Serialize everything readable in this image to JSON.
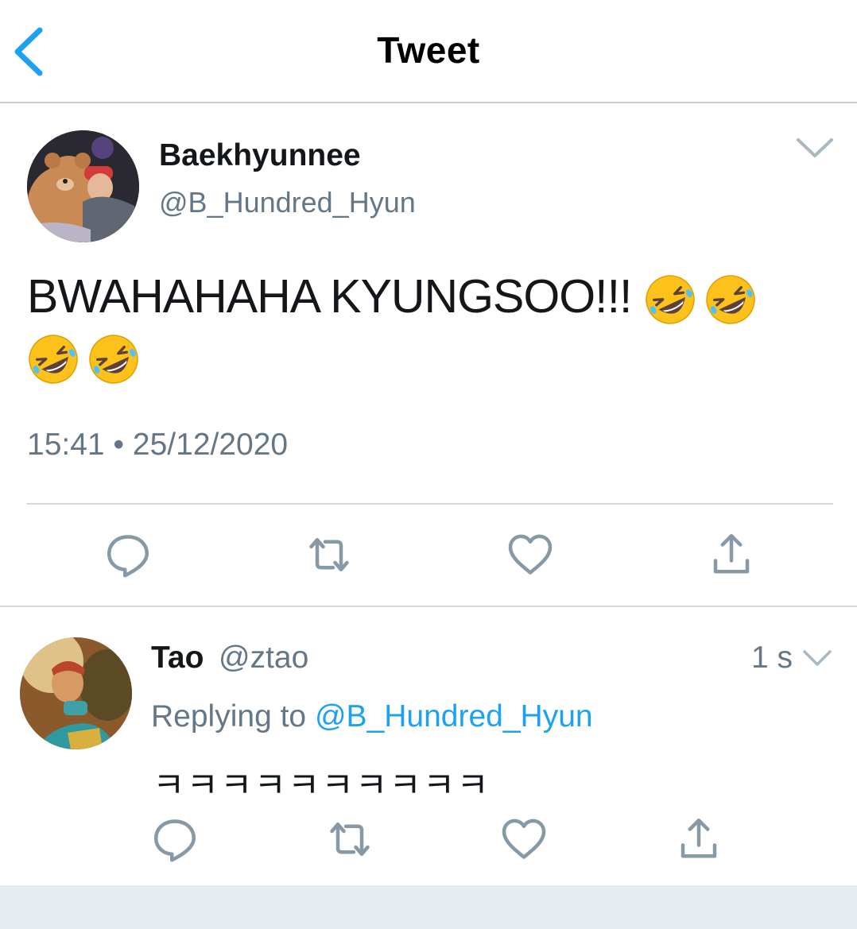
{
  "header": {
    "title": "Tweet",
    "back_icon": "chevron-left-icon"
  },
  "colors": {
    "accent": "#1da1f2",
    "secondary_text": "#657786",
    "divider": "#d4d9dd",
    "bottom_bar": "#e6ecf0"
  },
  "main_tweet": {
    "display_name": "Baekhyunnee",
    "handle": "@B_Hundred_Hyun",
    "text": "BWAHAHAHA KYUNGSOO!!!",
    "emoji": [
      "rolling-on-floor-laughing",
      "rolling-on-floor-laughing",
      "rolling-on-floor-laughing",
      "rolling-on-floor-laughing"
    ],
    "timestamp": "15:41 • 25/12/2020",
    "actions": [
      "reply-icon",
      "retweet-icon",
      "like-icon",
      "share-icon"
    ]
  },
  "reply_tweet": {
    "display_name": "Tao",
    "handle": "@ztao",
    "time": "1 s",
    "replying_prefix": "Replying to",
    "replying_to": "@B_Hundred_Hyun",
    "text": "ㅋㅋㅋㅋㅋㅋㅋㅋㅋㅋ",
    "actions": [
      "reply-icon",
      "retweet-icon",
      "like-icon",
      "share-icon"
    ]
  }
}
